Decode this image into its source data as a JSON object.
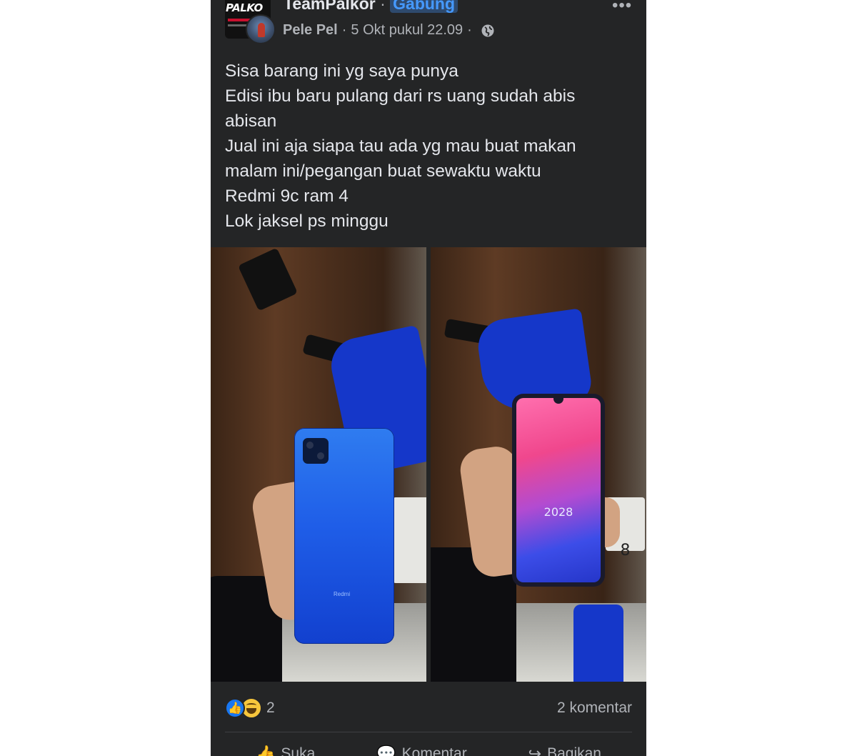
{
  "header": {
    "group_name": "TeamPalkor",
    "separator": "·",
    "join_label": "Gabung",
    "group_logo_text": "PALKO",
    "author": "Pele Pel",
    "timestamp": "5 Okt pukul 22.09",
    "privacy_icon": "globe-icon",
    "more_icon": "more-options-icon",
    "more_glyph": "•••"
  },
  "post": {
    "lines": [
      "Sisa barang ini yg saya punya",
      "Edisi ibu baru pulang dari rs uang sudah abis",
      "abisan",
      "Jual ini aja siapa tau ada yg mau buat makan",
      "malam ini/pegangan buat sewaktu waktu",
      "Redmi 9c ram 4",
      "Lok jaksel ps minggu"
    ]
  },
  "photos": {
    "back_brand": "Redmi",
    "front_clock": "2028",
    "plate_right": "8"
  },
  "footer": {
    "reaction_icons": [
      "like-icon",
      "haha-icon"
    ],
    "reaction_count": "2",
    "comment_count": "2 komentar",
    "actions": [
      {
        "label": "Suka",
        "icon": "like-icon"
      },
      {
        "label": "Komentar",
        "icon": "comment-icon"
      },
      {
        "label": "Bagikan",
        "icon": "share-icon"
      }
    ]
  },
  "colors": {
    "card_bg": "#242526",
    "text": "#e4e6eb",
    "muted": "#b0b3b8",
    "link": "#4599ff",
    "like_blue": "#1877f2"
  }
}
